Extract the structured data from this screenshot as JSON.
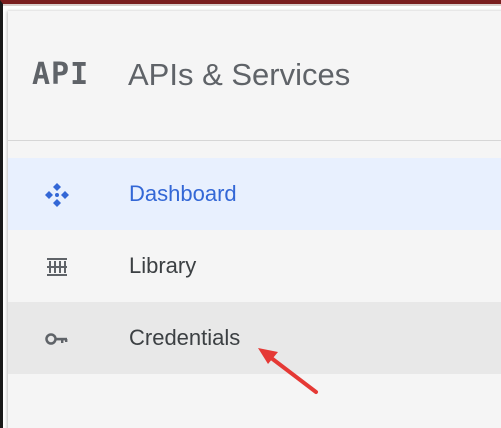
{
  "header": {
    "logo_text": "API",
    "title": "APIs & Services"
  },
  "nav": {
    "items": [
      {
        "label": "Dashboard",
        "icon": "dashboard-icon",
        "state": "active"
      },
      {
        "label": "Library",
        "icon": "library-icon",
        "state": "default"
      },
      {
        "label": "Credentials",
        "icon": "key-icon",
        "state": "hover"
      }
    ]
  },
  "colors": {
    "active_text": "#3367d6",
    "active_bg": "#e8f0fe",
    "hover_bg": "#e8e8e8",
    "annotation_arrow": "#e53935"
  }
}
